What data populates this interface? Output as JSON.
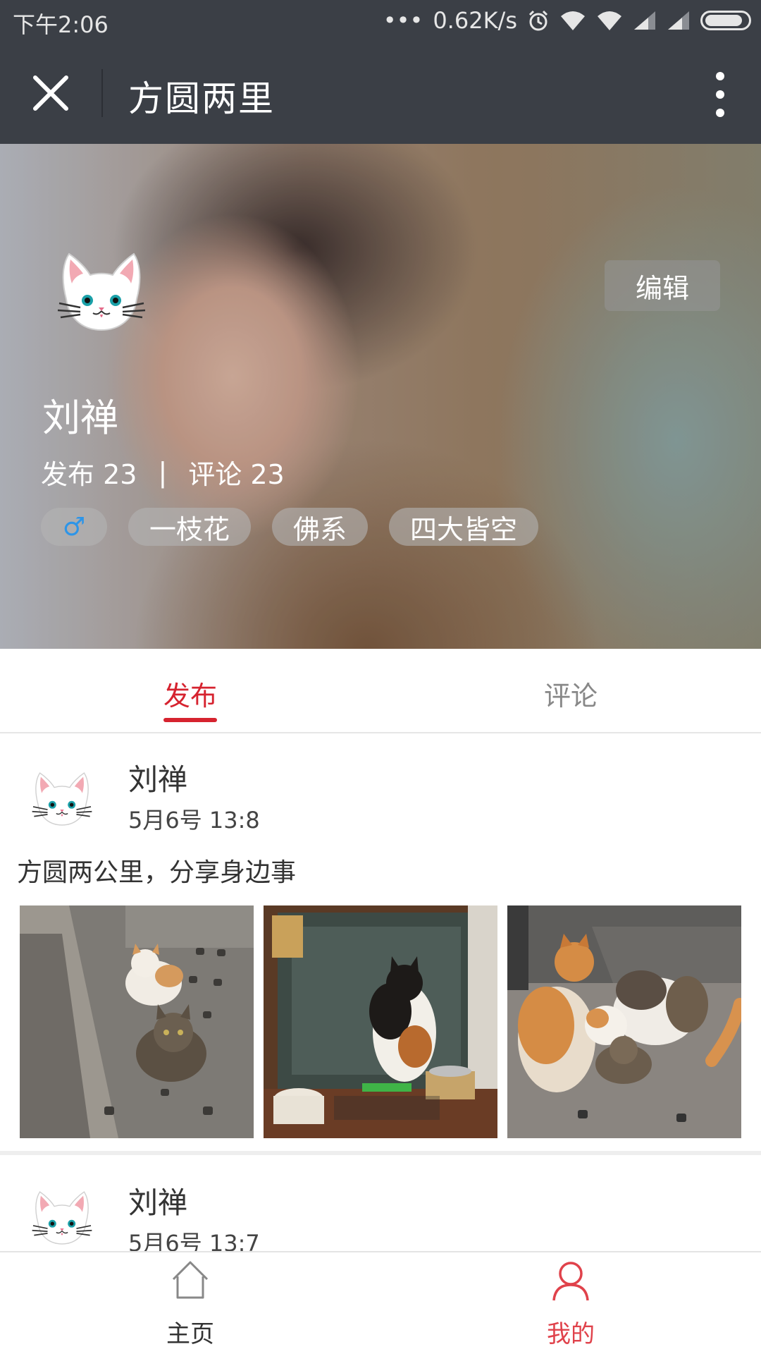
{
  "status_bar": {
    "time": "下午2:06",
    "dots": "•••",
    "speed": "0.62K/s",
    "icons": [
      "alarm-icon",
      "wifi-icon",
      "wifi-icon",
      "signal-icon",
      "signal-icon",
      "battery-icon"
    ]
  },
  "title_bar": {
    "close_icon": "close-icon",
    "title": "方圆两里",
    "more_icon": "more-vertical-icon"
  },
  "profile": {
    "edit_label": "编辑",
    "name": "刘禅",
    "posts_label": "发布 23",
    "separator": "|",
    "comments_label": "评论 23",
    "tags": [
      "♂",
      "一枝花",
      "佛系",
      "四大皆空"
    ],
    "gender_color": "#2d95e8"
  },
  "tabs": {
    "items": [
      {
        "label": "发布",
        "active": true
      },
      {
        "label": "评论",
        "active": false
      }
    ],
    "active_color": "#d6232f"
  },
  "posts": [
    {
      "author": "刘禅",
      "time": "5月6号 13:8",
      "text": "方圆两公里，分享身边事",
      "photos": [
        "cat-photo",
        "cat-photo",
        "cat-photo"
      ]
    },
    {
      "author": "刘禅",
      "time": "5月6号 13:7"
    }
  ],
  "bottom_nav": {
    "items": [
      {
        "label": "主页",
        "icon": "home-icon",
        "active": false
      },
      {
        "label": "我的",
        "icon": "user-icon",
        "active": true
      }
    ],
    "active_color": "#e0424b"
  }
}
